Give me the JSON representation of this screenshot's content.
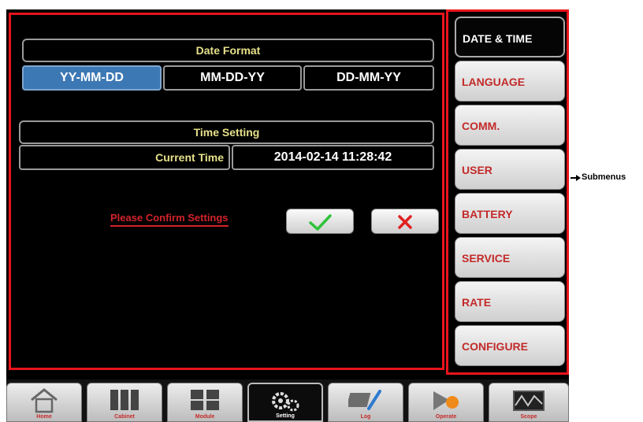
{
  "date_format": {
    "title": "Date Format",
    "options": [
      "YY-MM-DD",
      "MM-DD-YY",
      "DD-MM-YY"
    ],
    "selected": "YY-MM-DD"
  },
  "time_setting": {
    "title": "Time Setting",
    "label": "Current Time",
    "value": "2014-02-14  11:28:42"
  },
  "confirm": {
    "text": "Please Confirm Settings",
    "ok_icon": "check-icon",
    "cancel_icon": "close-icon"
  },
  "submenu": {
    "items": [
      "DATE & TIME",
      "LANGUAGE",
      "COMM.",
      "USER",
      "BATTERY",
      "SERVICE",
      "RATE",
      "CONFIGURE"
    ],
    "selected": "DATE & TIME"
  },
  "bottom_tabs": [
    "Home",
    "Cabinet",
    "Module",
    "Setting",
    "Log",
    "Operate",
    "Scope"
  ],
  "bottom_tab_selected": "Setting",
  "annotation": {
    "label": "Submenus"
  },
  "colors": {
    "highlight": "#e8141b",
    "selected_format": "#3c78b4",
    "title_text": "#e6e08a"
  }
}
